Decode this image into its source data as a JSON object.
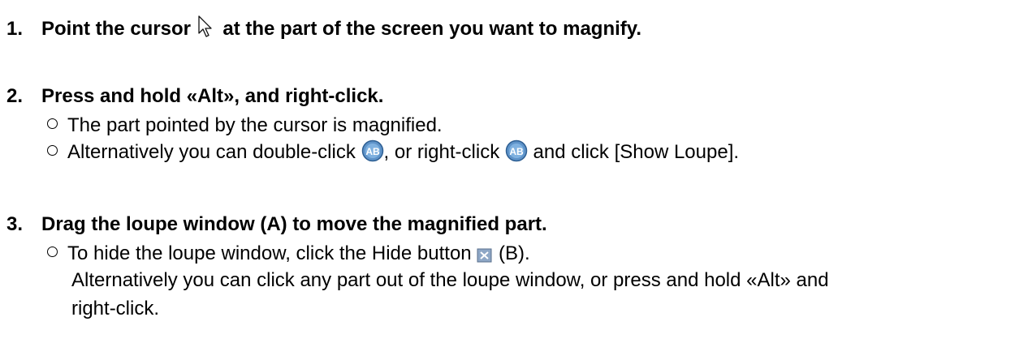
{
  "steps": [
    {
      "number": "1.",
      "text_before_icon": "Point the cursor",
      "icon": "cursor-arrow-icon",
      "text_after_icon": "at the part of the screen you want to magnify."
    },
    {
      "number": "2.",
      "text": "Press and hold «Alt», and right-click.",
      "bullets": [
        {
          "text": "The part pointed by the cursor is magnified."
        },
        {
          "part1": "Alternatively you can double-click",
          "icon1": "ab-loupe-icon",
          "part2": ", or right-click",
          "icon2": "ab-loupe-icon",
          "part3": "and click [Show Loupe]."
        }
      ]
    },
    {
      "number": "3.",
      "text": "Drag the loupe window (A) to move the magnified part.",
      "bullets": [
        {
          "part1": "To hide the loupe window, click the Hide button",
          "icon": "hide-button-icon",
          "part2": "(B).",
          "continuation_line1": "Alternatively you can click any part out of the loupe window, or press and hold «Alt» and",
          "continuation_line2": "right-click."
        }
      ]
    }
  ]
}
